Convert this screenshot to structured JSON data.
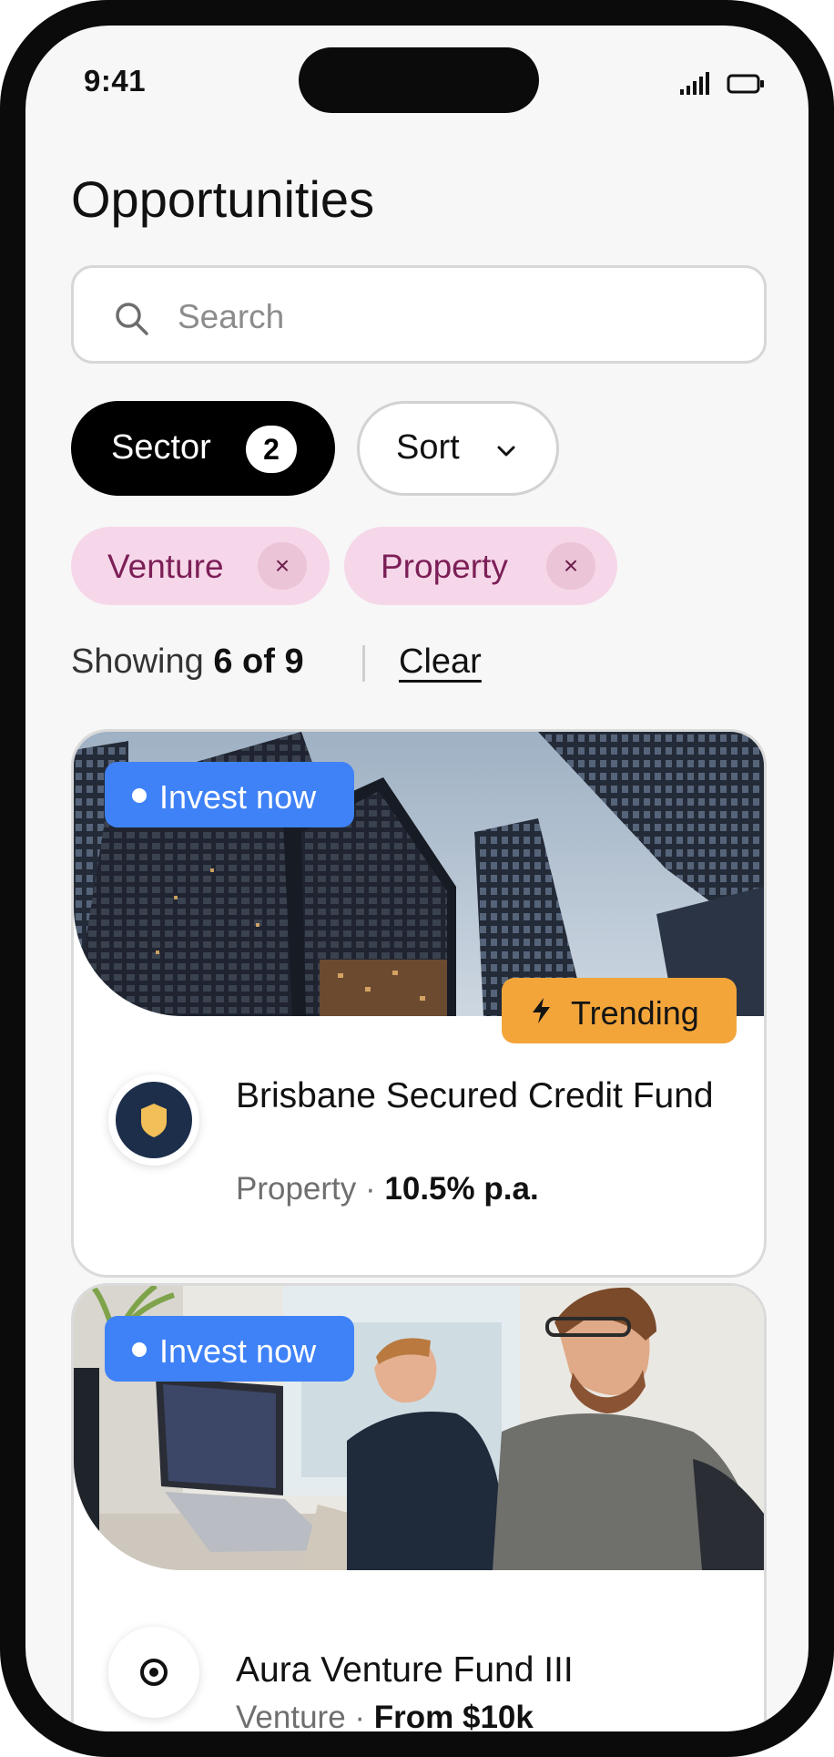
{
  "status_bar": {
    "time": "9:41",
    "signal_icon": "signal-bars-icon",
    "battery_icon": "battery-icon"
  },
  "page": {
    "title": "Opportunities"
  },
  "search": {
    "placeholder": "Search",
    "value": "",
    "icon": "search-icon"
  },
  "filters": {
    "sector": {
      "label": "Sector",
      "count": "2"
    },
    "sort": {
      "label": "Sort",
      "icon": "chevron-down-icon"
    },
    "active_tags": [
      {
        "label": "Venture",
        "remove_symbol": "×"
      },
      {
        "label": "Property",
        "remove_symbol": "×"
      }
    ]
  },
  "results": {
    "prefix": "Showing",
    "count_text": "6 of 9",
    "clear_label": "Clear"
  },
  "cards": [
    {
      "badge": "Invest now",
      "tag": "Trending",
      "tag_icon": "lightning-icon",
      "logo_icon": "shield-icon",
      "title": "Brisbane Secured Credit Fund",
      "sector": "Property",
      "separator": "·",
      "detail": "10.5% p.a.",
      "image": "office-towers-photo"
    },
    {
      "badge": "Invest now",
      "logo_icon": "target-icon",
      "title": "Aura Venture Fund III",
      "sector": "Venture",
      "separator": "·",
      "detail": "From $10k",
      "image": "team-at-desk-photo"
    }
  ],
  "colors": {
    "invest_badge": "#3f82f7",
    "trending_badge": "#f3a53a",
    "tag_bg": "#f6d7e9",
    "tag_text": "#7c1f57",
    "sector_chip": "#000000",
    "logo_navy": "#1c2e4a",
    "logo_gold": "#f2bf58"
  }
}
